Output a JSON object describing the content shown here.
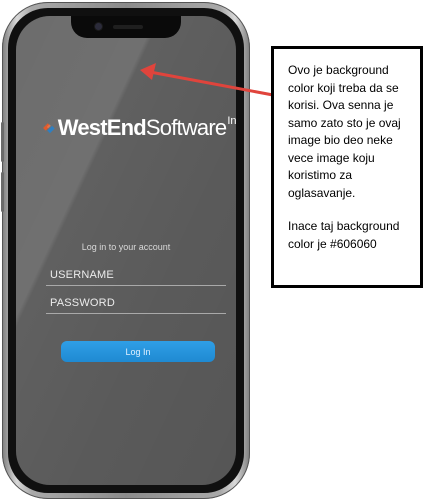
{
  "app": {
    "logo": {
      "west": "West",
      "end": "End",
      "software": "Software",
      "inc": "Inc"
    },
    "login": {
      "title": "Log in to your account",
      "username_placeholder": "USERNAME",
      "password_placeholder": "PASSWORD",
      "button_label": "Log In"
    },
    "screen_background": "#606060",
    "accent_color": "#2196e0",
    "logo_colors": [
      "#e05a2b",
      "#2f7fc1"
    ]
  },
  "annotation": {
    "paragraph1": "Ovo je background color koji treba da se korisi. Ova senna je samo zato sto je ovaj image bio deo neke vece image koju koristimo za oglasavanje.",
    "paragraph2": "Inace taj background color je #606060",
    "arrow_color": "#e0443c",
    "arrow_icon": "red-arrow-icon"
  }
}
